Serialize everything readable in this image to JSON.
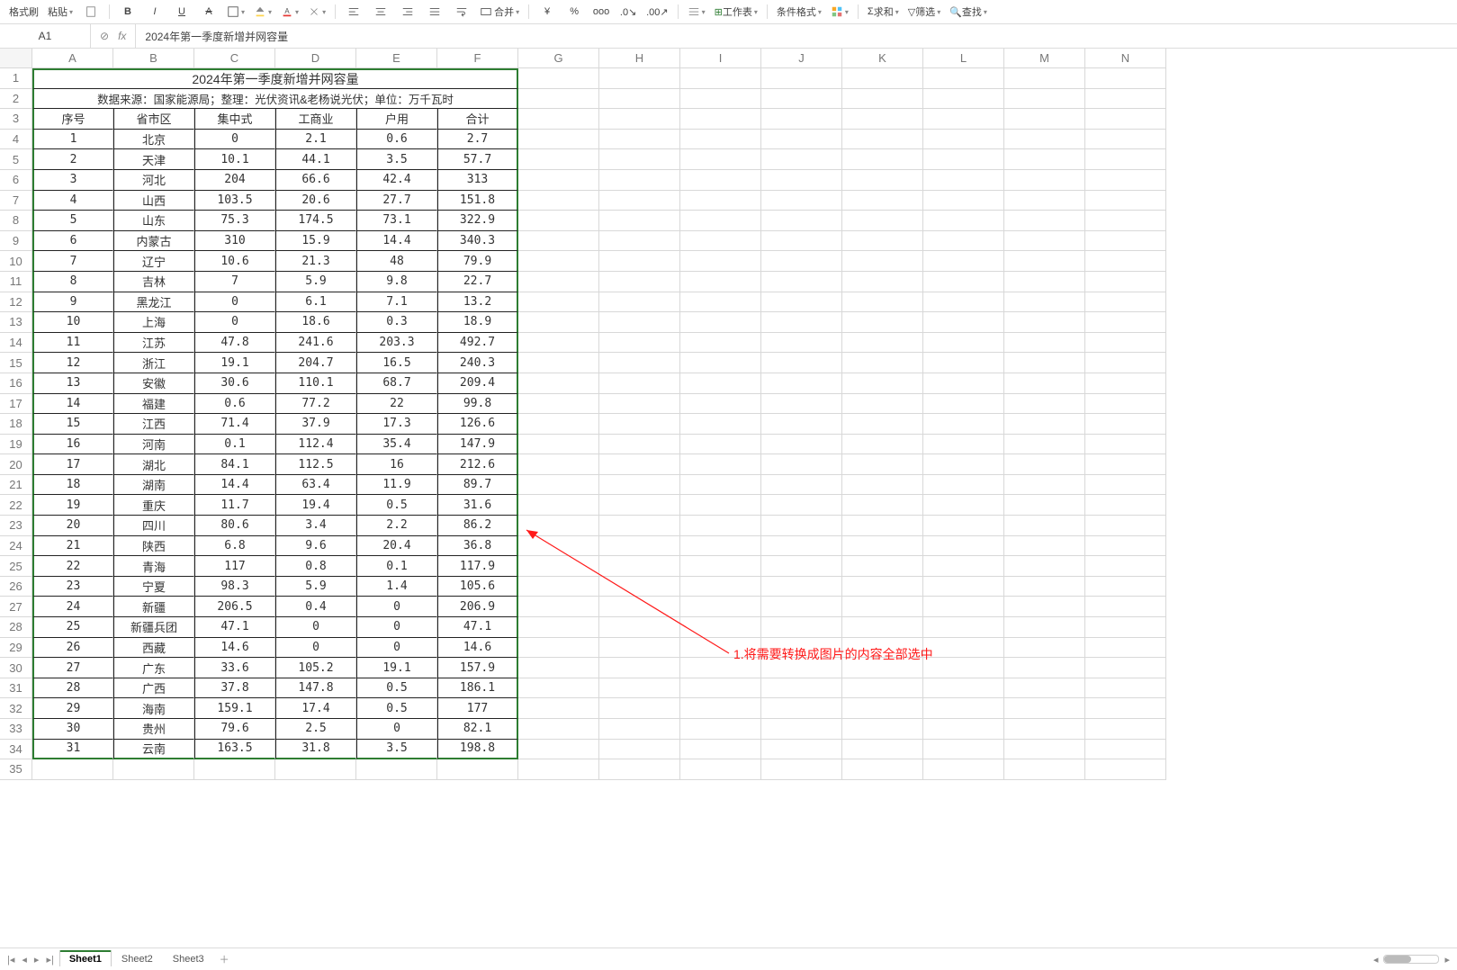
{
  "toolbar": {
    "format_painter": "格式刷",
    "paste": "粘贴",
    "bold": "B",
    "italic": "I",
    "underline": "U",
    "strike": "A",
    "merge": "合并",
    "worksheet": "工作表",
    "cond_fmt": "条件格式",
    "sum": "求和",
    "filter": "筛选",
    "find": "查找"
  },
  "fbar": {
    "cell_ref": "A1",
    "formula": "2024年第一季度新增并网容量"
  },
  "columns": [
    "A",
    "B",
    "C",
    "D",
    "E",
    "F",
    "G",
    "H",
    "I",
    "J",
    "K",
    "L",
    "M",
    "N"
  ],
  "row_count": 35,
  "sheet_tabs": [
    "Sheet1",
    "Sheet2",
    "Sheet3"
  ],
  "active_sheet": 0,
  "annotation": "1.将需要转换成图片的内容全部选中",
  "chart_data": {
    "type": "table",
    "title": "2024年第一季度新增并网容量",
    "subtitle": "数据来源：国家能源局；整理：光伏资讯&老杨说光伏；单位：万千瓦时",
    "headers": [
      "序号",
      "省市区",
      "集中式",
      "工商业",
      "户用",
      "合计"
    ],
    "rows": [
      [
        "1",
        "北京",
        "0",
        "2.1",
        "0.6",
        "2.7"
      ],
      [
        "2",
        "天津",
        "10.1",
        "44.1",
        "3.5",
        "57.7"
      ],
      [
        "3",
        "河北",
        "204",
        "66.6",
        "42.4",
        "313"
      ],
      [
        "4",
        "山西",
        "103.5",
        "20.6",
        "27.7",
        "151.8"
      ],
      [
        "5",
        "山东",
        "75.3",
        "174.5",
        "73.1",
        "322.9"
      ],
      [
        "6",
        "内蒙古",
        "310",
        "15.9",
        "14.4",
        "340.3"
      ],
      [
        "7",
        "辽宁",
        "10.6",
        "21.3",
        "48",
        "79.9"
      ],
      [
        "8",
        "吉林",
        "7",
        "5.9",
        "9.8",
        "22.7"
      ],
      [
        "9",
        "黑龙江",
        "0",
        "6.1",
        "7.1",
        "13.2"
      ],
      [
        "10",
        "上海",
        "0",
        "18.6",
        "0.3",
        "18.9"
      ],
      [
        "11",
        "江苏",
        "47.8",
        "241.6",
        "203.3",
        "492.7"
      ],
      [
        "12",
        "浙江",
        "19.1",
        "204.7",
        "16.5",
        "240.3"
      ],
      [
        "13",
        "安徽",
        "30.6",
        "110.1",
        "68.7",
        "209.4"
      ],
      [
        "14",
        "福建",
        "0.6",
        "77.2",
        "22",
        "99.8"
      ],
      [
        "15",
        "江西",
        "71.4",
        "37.9",
        "17.3",
        "126.6"
      ],
      [
        "16",
        "河南",
        "0.1",
        "112.4",
        "35.4",
        "147.9"
      ],
      [
        "17",
        "湖北",
        "84.1",
        "112.5",
        "16",
        "212.6"
      ],
      [
        "18",
        "湖南",
        "14.4",
        "63.4",
        "11.9",
        "89.7"
      ],
      [
        "19",
        "重庆",
        "11.7",
        "19.4",
        "0.5",
        "31.6"
      ],
      [
        "20",
        "四川",
        "80.6",
        "3.4",
        "2.2",
        "86.2"
      ],
      [
        "21",
        "陕西",
        "6.8",
        "9.6",
        "20.4",
        "36.8"
      ],
      [
        "22",
        "青海",
        "117",
        "0.8",
        "0.1",
        "117.9"
      ],
      [
        "23",
        "宁夏",
        "98.3",
        "5.9",
        "1.4",
        "105.6"
      ],
      [
        "24",
        "新疆",
        "206.5",
        "0.4",
        "0",
        "206.9"
      ],
      [
        "25",
        "新疆兵团",
        "47.1",
        "0",
        "0",
        "47.1"
      ],
      [
        "26",
        "西藏",
        "14.6",
        "0",
        "0",
        "14.6"
      ],
      [
        "27",
        "广东",
        "33.6",
        "105.2",
        "19.1",
        "157.9"
      ],
      [
        "28",
        "广西",
        "37.8",
        "147.8",
        "0.5",
        "186.1"
      ],
      [
        "29",
        "海南",
        "159.1",
        "17.4",
        "0.5",
        "177"
      ],
      [
        "30",
        "贵州",
        "79.6",
        "2.5",
        "0",
        "82.1"
      ],
      [
        "31",
        "云南",
        "163.5",
        "31.8",
        "3.5",
        "198.8"
      ]
    ]
  }
}
